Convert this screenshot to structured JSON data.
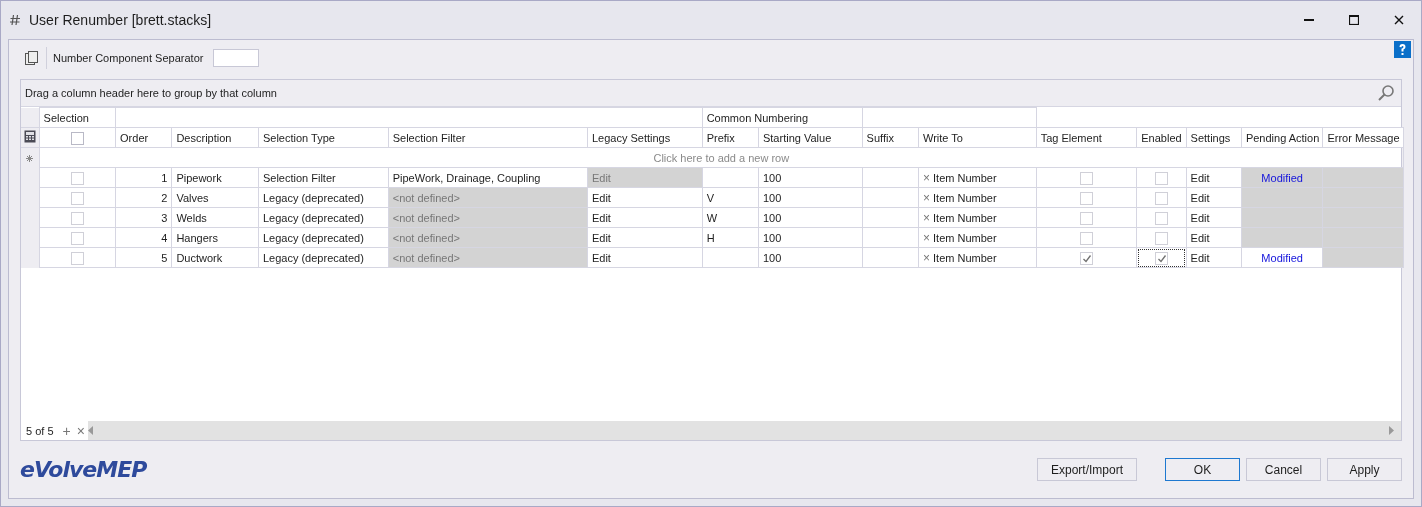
{
  "window": {
    "title": "User Renumber [brett.stacks]"
  },
  "toolbar": {
    "separator_label": "Number Component Separator"
  },
  "grid": {
    "group_panel": "Drag a column header here to group by that column",
    "bands": [
      {
        "label": "Selection"
      },
      {
        "label": "Common Numbering"
      }
    ],
    "select_all_checked": false,
    "columns": [
      "Order",
      "Description",
      "Selection Type",
      "Selection Filter",
      "Legacy Settings",
      "Prefix",
      "Starting Value",
      "Suffix",
      "Write To",
      "Tag Element",
      "Enabled",
      "Settings",
      "Pending Action",
      "Error Message"
    ],
    "new_row": "Click here to add a new row",
    "rows": [
      {
        "selected": false,
        "order": "1",
        "description": "Pipework",
        "selection_type": "Selection Filter",
        "selection_filter": "PipeWork, Drainage, Coupling",
        "filter_disabled": false,
        "legacy_settings": "Edit",
        "legacy_disabled": true,
        "prefix": "",
        "starting_value": "100",
        "suffix": "",
        "write_to_icon": "×",
        "write_to": "Item Number",
        "tag_element": false,
        "enabled": false,
        "settings": "Edit",
        "pending_action": "Modified",
        "pending_disabled": true
      },
      {
        "selected": false,
        "order": "2",
        "description": "Valves",
        "selection_type": "Legacy (deprecated)",
        "selection_filter": "<not defined>",
        "filter_disabled": true,
        "legacy_settings": "Edit",
        "legacy_disabled": false,
        "prefix": "V",
        "starting_value": "100",
        "suffix": "",
        "write_to_icon": "×",
        "write_to": "Item Number",
        "tag_element": false,
        "enabled": false,
        "settings": "Edit",
        "pending_action": "",
        "pending_disabled": true
      },
      {
        "selected": false,
        "order": "3",
        "description": "Welds",
        "selection_type": "Legacy (deprecated)",
        "selection_filter": "<not defined>",
        "filter_disabled": true,
        "legacy_settings": "Edit",
        "legacy_disabled": false,
        "prefix": "W",
        "starting_value": "100",
        "suffix": "",
        "write_to_icon": "×",
        "write_to": "Item Number",
        "tag_element": false,
        "enabled": false,
        "settings": "Edit",
        "pending_action": "",
        "pending_disabled": true
      },
      {
        "selected": false,
        "order": "4",
        "description": "Hangers",
        "selection_type": "Legacy (deprecated)",
        "selection_filter": "<not defined>",
        "filter_disabled": true,
        "legacy_settings": "Edit",
        "legacy_disabled": false,
        "prefix": "H",
        "starting_value": "100",
        "suffix": "",
        "write_to_icon": "×",
        "write_to": "Item Number",
        "tag_element": false,
        "enabled": false,
        "settings": "Edit",
        "pending_action": "",
        "pending_disabled": true
      },
      {
        "selected": false,
        "order": "5",
        "description": "Ductwork",
        "selection_type": "Legacy (deprecated)",
        "selection_filter": "<not defined>",
        "filter_disabled": true,
        "legacy_settings": "Edit",
        "legacy_disabled": false,
        "prefix": "",
        "starting_value": "100",
        "suffix": "",
        "write_to_icon": "×",
        "write_to": "Item Number",
        "tag_element": true,
        "enabled": true,
        "settings": "Edit",
        "pending_action": "Modified",
        "pending_disabled": false
      }
    ],
    "navigator": {
      "record": "5 of 5",
      "add": "+",
      "remove": "×"
    }
  },
  "logo": "eVolveMEP",
  "buttons": [
    {
      "label": "Export/Import",
      "default": false
    },
    {
      "label": "OK",
      "default": true
    },
    {
      "label": "Cancel",
      "default": false
    },
    {
      "label": "Apply",
      "default": false
    }
  ]
}
